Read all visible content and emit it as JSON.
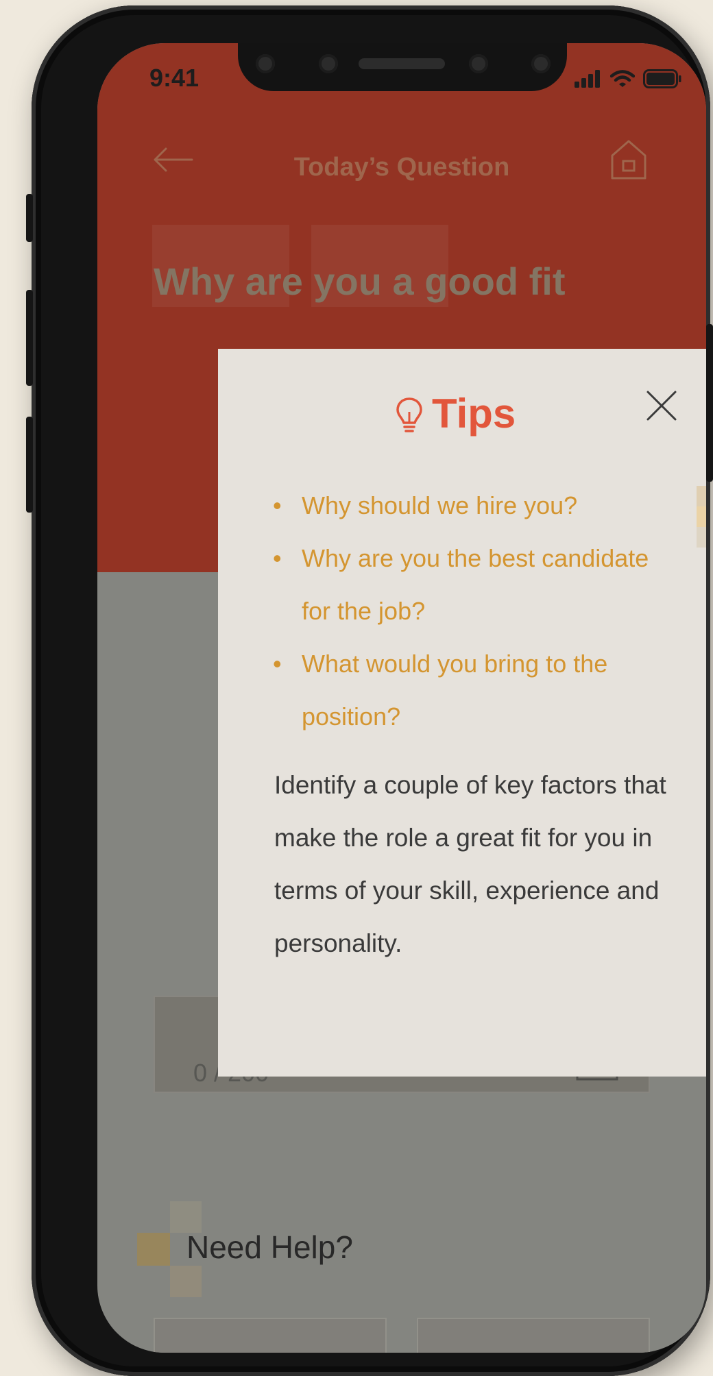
{
  "status_bar": {
    "time": "9:41"
  },
  "nav": {
    "title": "Today’s Question"
  },
  "question": {
    "text": "Why are you a good fit"
  },
  "answer": {
    "counter": "0 / 200"
  },
  "help": {
    "title": "Need Help?"
  },
  "modal": {
    "title": "Tips",
    "tips": [
      "Why should we hire you?",
      "Why are you the best candidate for the job?",
      "What would you bring to the position?"
    ],
    "body": "Identify a couple of key factors that make the role a great fit for you in terms of your skill, experience and personality."
  },
  "colors": {
    "hero_red": "#9b3221",
    "tips_title": "#e2563b",
    "tips_bullets": "#d49530",
    "modal_bg": "#e6e2dc"
  },
  "icons": [
    "back-arrow-icon",
    "home-icon",
    "lightbulb-icon",
    "close-icon",
    "document-icon",
    "signal-icon",
    "wifi-icon",
    "battery-icon"
  ]
}
